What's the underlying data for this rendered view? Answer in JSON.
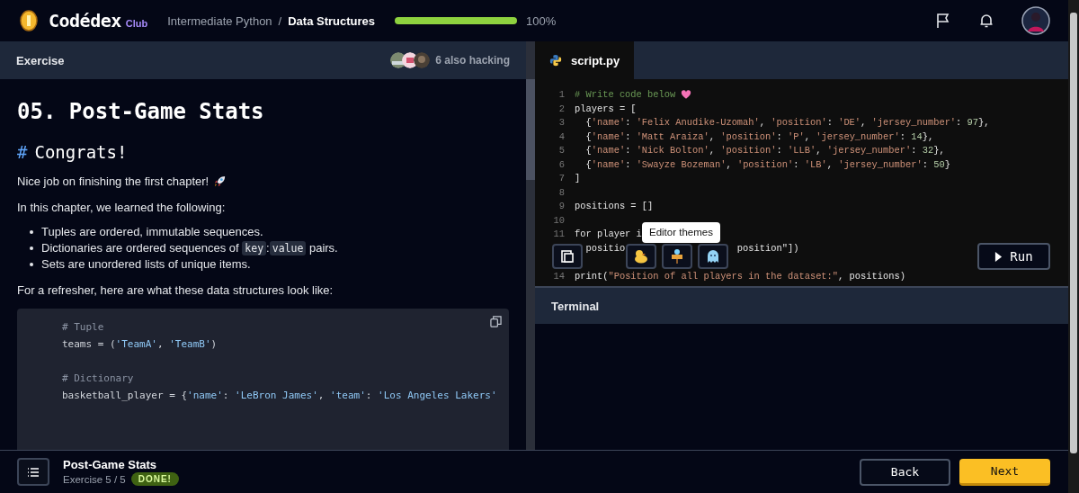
{
  "topbar": {
    "logo": "Codédex",
    "logo_badge": "Club",
    "breadcrumb": [
      {
        "label": "Intermediate Python",
        "selected": false
      },
      {
        "label": "Data Structures",
        "selected": true
      }
    ],
    "separator": "/",
    "progress": {
      "level": 1.0,
      "reading": "100%"
    }
  },
  "exercise_panel": {
    "title": "Exercise",
    "hacking": "6 also hacking"
  },
  "lesson": {
    "title": "05. Post-Game Stats",
    "heading_mark": "#",
    "heading": "Congrats!",
    "intro": "Nice job on finishing the first chapter!",
    "lead": "In this chapter, we learned the following:",
    "bullets": [
      [
        {
          "kind": "text",
          "text": "Tuples are ordered, immutable sequences."
        }
      ],
      [
        {
          "kind": "text",
          "text": "Dictionaries are ordered sequences of "
        },
        {
          "kind": "code",
          "text": "key"
        },
        {
          "kind": "text",
          "text": ":"
        },
        {
          "kind": "code",
          "text": "value"
        },
        {
          "kind": "text",
          "text": " pairs."
        }
      ],
      [
        {
          "kind": "text",
          "text": "Sets are unordered lists of unique items."
        }
      ]
    ],
    "outro": "For a refresher, here are what these data structures look like:",
    "code_block": [
      {
        "kind": "comment",
        "code": "# Tuple"
      },
      {
        "kind": "code",
        "code": "teams = ('TeamA', 'TeamB')"
      },
      {
        "kind": "blank"
      },
      {
        "kind": "comment",
        "code": "# Dictionary"
      },
      {
        "kind": "code",
        "code": "basketball_player = {'name': 'LeBron James', 'team': 'Los Angeles Lakers'"
      }
    ]
  },
  "editor": {
    "tab": "script.py",
    "lines": [
      {
        "kind": "code",
        "num": "1",
        "code": "# Write code below"
      },
      {
        "kind": "code",
        "num": "2",
        "code": "players = ["
      },
      {
        "kind": "code",
        "num": "3",
        "code": "  {'name': 'Felix Anudike-Uzomah', 'position': 'DE', 'jersey_number': 97},"
      },
      {
        "kind": "code",
        "num": "4",
        "code": "  {'name': 'Matt Araiza', 'position': 'P', 'jersey_number': 14},"
      },
      {
        "kind": "code",
        "num": "5",
        "code": "  {'name': 'Nick Bolton', 'position': 'LLB', 'jersey_number': 32},"
      },
      {
        "kind": "code",
        "num": "6",
        "code": "  {'name': 'Swayze Bozeman', 'position': 'LB', 'jersey_number': 50}"
      },
      {
        "kind": "code",
        "num": "7",
        "code": "]"
      },
      {
        "kind": "blank",
        "num": "8"
      },
      {
        "kind": "code",
        "num": "9",
        "code": "positions = []"
      },
      {
        "kind": "blank",
        "num": "10"
      },
      {
        "kind": "code",
        "num": "11",
        "code": "for player i"
      },
      {
        "kind": "code",
        "code": "  positio",
        "after_gap": "position\"])"
      },
      {
        "kind": "blank"
      },
      {
        "kind": "code",
        "num": "14",
        "code": "print(\"Position of all players in the dataset:\", positions)"
      }
    ],
    "tooltip": "Editor themes",
    "run": "Run"
  },
  "terminal": {
    "title": "Terminal"
  },
  "footer": {
    "title": "Post-Game Stats",
    "progress": "Exercise 5 / 5",
    "badge": "DONE!",
    "back": "Back",
    "next": "Next"
  }
}
